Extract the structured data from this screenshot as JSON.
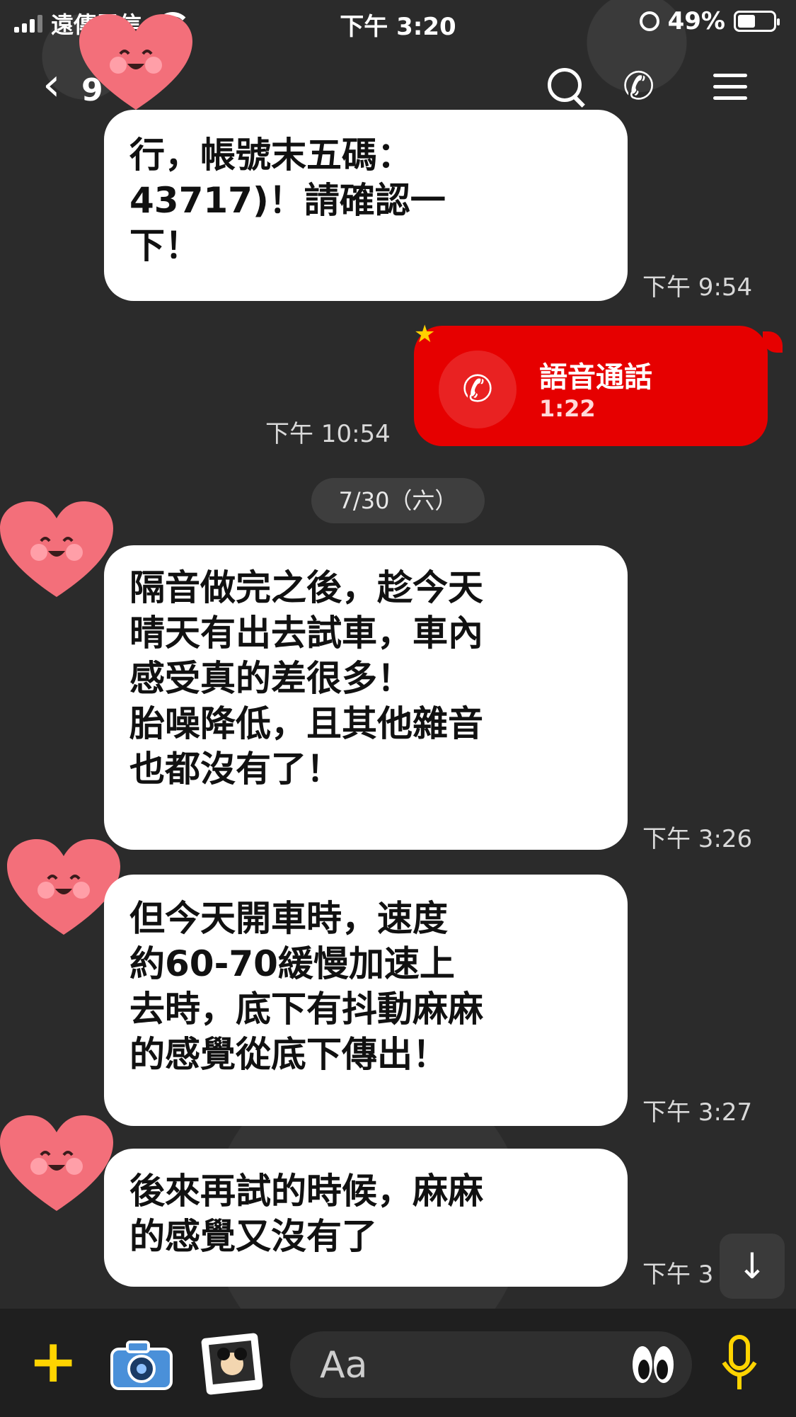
{
  "status_bar": {
    "carrier": "遠傳電信",
    "time": "下午 3:20",
    "battery": "49%"
  },
  "header": {
    "chat_name_partial": "9",
    "back_icon": "chevron-left-icon",
    "icons": [
      "search-icon",
      "phone-icon",
      "menu-icon"
    ]
  },
  "messages": [
    {
      "text": "行，帳號末五碼：\n43717)！請確認一\n下！",
      "time": "下午 9:54"
    },
    {
      "type": "call",
      "label": "語音通話",
      "duration": "1:22",
      "time": "下午 10:54"
    },
    {
      "type": "date",
      "text": "7/30（六）"
    },
    {
      "text": "隔音做完之後，趁今天\n晴天有出去試車，車內\n感受真的差很多！\n胎噪降低，且其他雜音\n也都沒有了！",
      "time": "下午 3:26"
    },
    {
      "text": "但今天開車時，速度\n約60-70緩慢加速上\n去時，底下有抖動麻麻\n的感覺從底下傳出！",
      "time": "下午 3:27"
    },
    {
      "text": "後來再試的時候，麻麻\n的感覺又沒有了",
      "time": "下午 3"
    }
  ],
  "input": {
    "placeholder": "Aa"
  },
  "colors": {
    "background": "#2b2b2b",
    "call_bubble": "#e60000",
    "accent_yellow": "#ffd400"
  }
}
